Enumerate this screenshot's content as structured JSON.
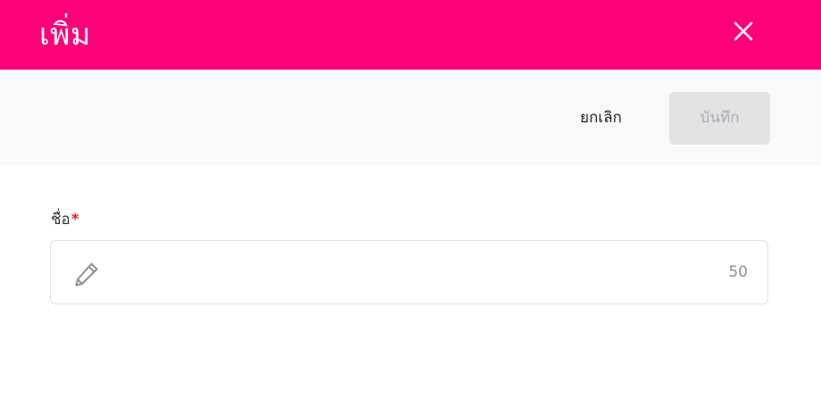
{
  "dialog": {
    "title": "เพิ่ม",
    "close_icon": "close-icon",
    "header_color": "#fe0179"
  },
  "toolbar": {
    "cancel_label": "ยกเลิก",
    "save_label": "บันทึก"
  },
  "form": {
    "name_field": {
      "label": "ชื่อ",
      "required_mark": "*",
      "value": "",
      "placeholder": "",
      "max_length_counter": "50",
      "icon": "pencil-icon"
    }
  }
}
